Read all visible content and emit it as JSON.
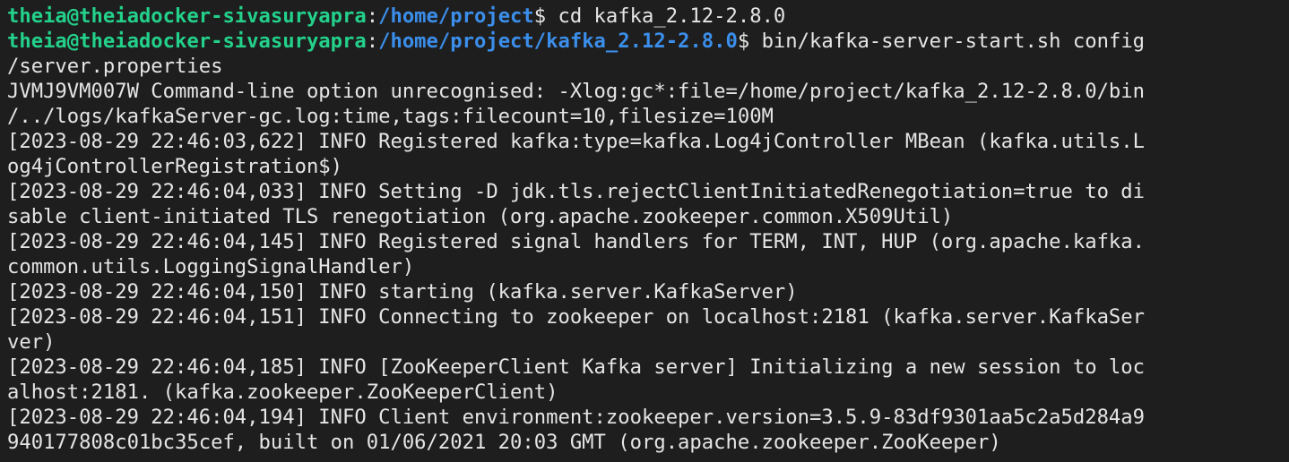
{
  "prompts": [
    {
      "user_host": "theia@theiadocker-sivasuryapra",
      "separator": ":",
      "path": "/home/project",
      "symbol": "$ ",
      "command": "cd kafka_2.12-2.8.0"
    },
    {
      "user_host": "theia@theiadocker-sivasuryapra",
      "separator": ":",
      "path": "/home/project/kafka_2.12-2.8.0",
      "symbol": "$ ",
      "command": "bin/kafka-server-start.sh config"
    }
  ],
  "output_lines": [
    "/server.properties",
    "JVMJ9VM007W Command-line option unrecognised: -Xlog:gc*:file=/home/project/kafka_2.12-2.8.0/bin",
    "/../logs/kafkaServer-gc.log:time,tags:filecount=10,filesize=100M",
    "[2023-08-29 22:46:03,622] INFO Registered kafka:type=kafka.Log4jController MBean (kafka.utils.L",
    "og4jControllerRegistration$)",
    "[2023-08-29 22:46:04,033] INFO Setting -D jdk.tls.rejectClientInitiatedRenegotiation=true to di",
    "sable client-initiated TLS renegotiation (org.apache.zookeeper.common.X509Util)",
    "[2023-08-29 22:46:04,145] INFO Registered signal handlers for TERM, INT, HUP (org.apache.kafka.",
    "common.utils.LoggingSignalHandler)",
    "[2023-08-29 22:46:04,150] INFO starting (kafka.server.KafkaServer)",
    "[2023-08-29 22:46:04,151] INFO Connecting to zookeeper on localhost:2181 (kafka.server.KafkaSer",
    "ver)",
    "[2023-08-29 22:46:04,185] INFO [ZooKeeperClient Kafka server] Initializing a new session to loc",
    "alhost:2181. (kafka.zookeeper.ZooKeeperClient)",
    "[2023-08-29 22:46:04,194] INFO Client environment:zookeeper.version=3.5.9-83df9301aa5c2a5d284a9",
    "940177808c01bc35cef, built on 01/06/2021 20:03 GMT (org.apache.zookeeper.ZooKeeper)"
  ],
  "colors": {
    "background": "#1e1e1e",
    "user_host": "#23d18b",
    "path": "#3b8eea",
    "text": "#e5e5e5"
  }
}
